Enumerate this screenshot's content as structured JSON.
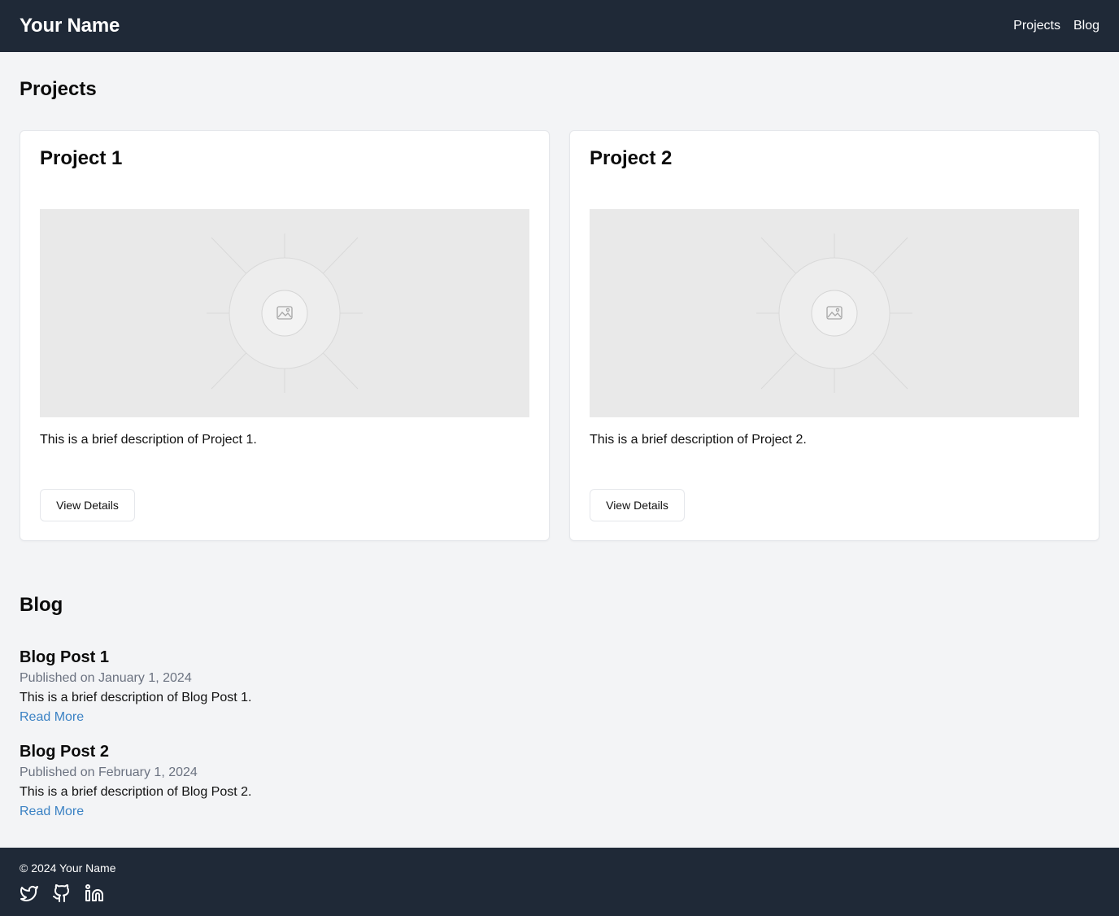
{
  "header": {
    "brand": "Your Name",
    "nav": [
      "Projects",
      "Blog"
    ]
  },
  "projects": {
    "title": "Projects",
    "items": [
      {
        "title": "Project 1",
        "description": "This is a brief description of Project 1.",
        "button": "View Details",
        "image_icon": "image-placeholder-icon"
      },
      {
        "title": "Project 2",
        "description": "This is a brief description of Project 2.",
        "button": "View Details",
        "image_icon": "image-placeholder-icon"
      }
    ]
  },
  "blog": {
    "title": "Blog",
    "posts": [
      {
        "title": "Blog Post 1",
        "date": "Published on January 1, 2024",
        "description": "This is a brief description of Blog Post 1.",
        "link": "Read More"
      },
      {
        "title": "Blog Post 2",
        "date": "Published on February 1, 2024",
        "description": "This is a brief description of Blog Post 2.",
        "link": "Read More"
      }
    ]
  },
  "footer": {
    "copyright": "© 2024 Your Name",
    "social_icons": [
      "twitter-icon",
      "github-icon",
      "linkedin-icon"
    ]
  },
  "colors": {
    "header_bg": "#1f2937",
    "page_bg": "#f3f4f6",
    "link": "#3b82c4",
    "muted_text": "#6b7280"
  }
}
